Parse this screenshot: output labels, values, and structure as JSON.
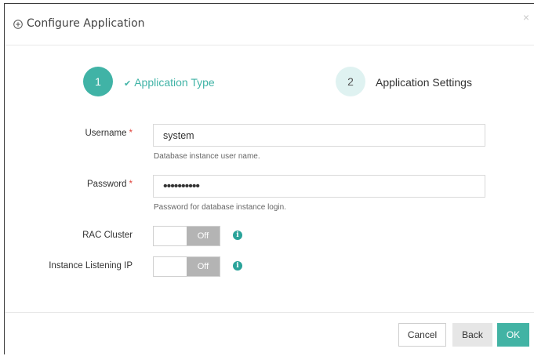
{
  "dialog": {
    "title": "Configure Application",
    "close_label": "×",
    "header_icon": "plus-circle-icon"
  },
  "steps": [
    {
      "number": "1",
      "label": "Application Type",
      "state": "active",
      "check": "✔"
    },
    {
      "number": "2",
      "label": "Application Settings",
      "state": "pending"
    }
  ],
  "form": {
    "username": {
      "label": "Username",
      "required_mark": "*",
      "value": "system",
      "help": "Database instance user name."
    },
    "password": {
      "label": "Password",
      "required_mark": "*",
      "value": "••••••••••",
      "help": "Password for database instance login."
    },
    "rac_cluster": {
      "label": "RAC Cluster",
      "toggle_text": "Off",
      "info_icon": "info-icon"
    },
    "instance_listening_ip": {
      "label": "Instance Listening IP",
      "toggle_text": "Off",
      "info_icon": "info-icon"
    }
  },
  "footer": {
    "cancel_label": "Cancel",
    "back_label": "Back",
    "ok_label": "OK"
  },
  "colors": {
    "accent": "#40b3a6",
    "step_pending_bg": "#dff2f1",
    "required": "#e0443c",
    "toggle_off": "#b4b4b4",
    "back_button_bg": "#e6e6e6"
  }
}
